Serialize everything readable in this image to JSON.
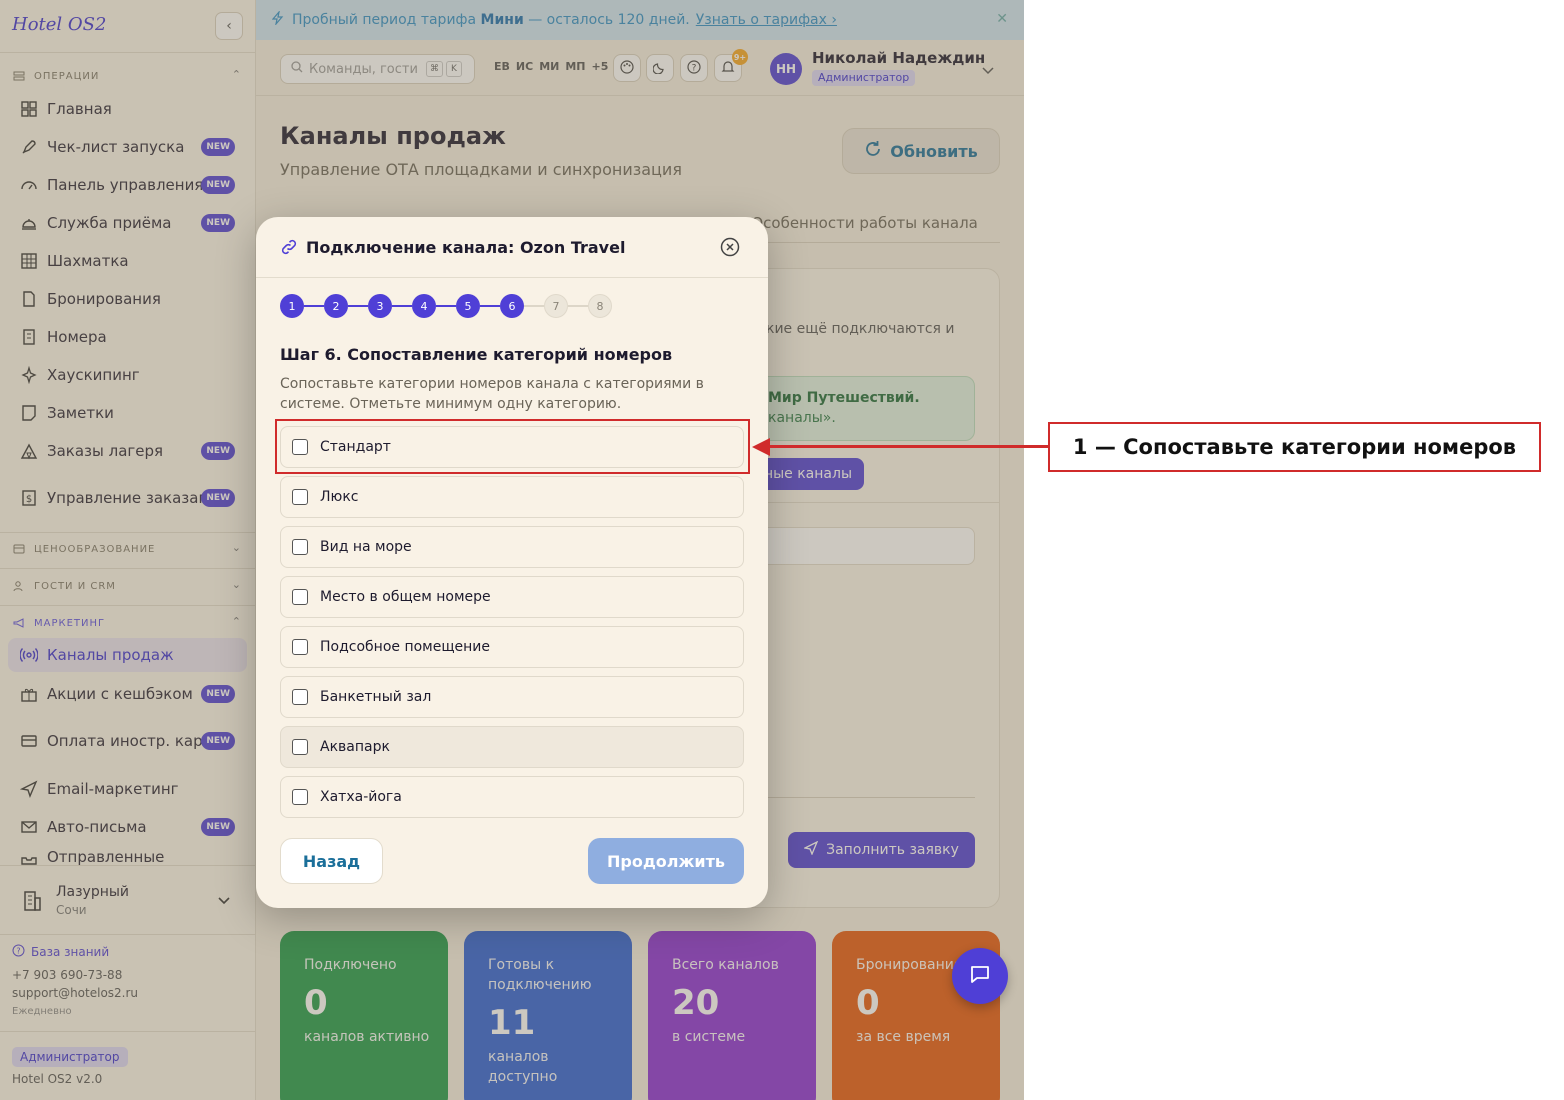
{
  "sidebar": {
    "logo": "Hotel OS2",
    "collapse_icon": "chevron-left-icon",
    "sections": {
      "operations": "ОПЕРАЦИИ",
      "pricing": "ЦЕНООБРАЗОВАНИЕ",
      "guests": "ГОСТИ И CRM",
      "marketing": "МАРКЕТИНГ"
    },
    "items": [
      {
        "label": "Главная",
        "icon": "grid-icon",
        "badge": ""
      },
      {
        "label": "Чек-лист запуска",
        "icon": "rocket-icon",
        "badge": "NEW"
      },
      {
        "label": "Панель управления",
        "icon": "gauge-icon",
        "badge": "NEW"
      },
      {
        "label": "Служба приёма",
        "icon": "bell-desk-icon",
        "badge": "NEW"
      },
      {
        "label": "Шахматка",
        "icon": "table-icon",
        "badge": ""
      },
      {
        "label": "Бронирования",
        "icon": "document-icon",
        "badge": ""
      },
      {
        "label": "Номера",
        "icon": "building-icon",
        "badge": ""
      },
      {
        "label": "Хаускипинг",
        "icon": "sparkles-icon",
        "badge": ""
      },
      {
        "label": "Заметки",
        "icon": "note-icon",
        "badge": ""
      },
      {
        "label": "Заказы лагеря",
        "icon": "tent-icon",
        "badge": "NEW"
      },
      {
        "label": "Управление заказами",
        "icon": "dollar-icon",
        "badge": "NEW"
      }
    ],
    "marketing_items": [
      {
        "label": "Каналы продаж",
        "icon": "broadcast-icon",
        "badge": ""
      },
      {
        "label": "Акции с кешбэком",
        "icon": "gift-icon",
        "badge": "NEW"
      },
      {
        "label": "Оплата иностр. картой",
        "icon": "card-icon",
        "badge": "NEW"
      },
      {
        "label": "Email-маркетинг",
        "icon": "send-icon",
        "badge": ""
      },
      {
        "label": "Авто-письма",
        "icon": "mail-icon",
        "badge": "NEW"
      },
      {
        "label": "Отправленные",
        "icon": "outbox-icon",
        "badge": ""
      }
    ],
    "hotel": {
      "name": "Лазурный",
      "city": "Сочи"
    },
    "footer": {
      "knowledge_base": "База знаний",
      "phone": "+7 903 690-73-88",
      "email": "support@hotelos2.ru",
      "hours": "Ежедневно",
      "role": "Администратор",
      "version": "Hotel OS2 v2.0"
    }
  },
  "trial_banner": {
    "prefix": "Пробный период тарифа",
    "plan": "Мини",
    "suffix": "— осталось 120 дней.",
    "link": "Узнать о тарифах ›"
  },
  "topbar": {
    "search_placeholder": "Команды, гости",
    "kbd1": "⌘",
    "kbd2": "K",
    "avatars": [
      "ЕВ",
      "ИС",
      "МИ",
      "МП",
      "+5"
    ],
    "notif_count": "9+",
    "user": {
      "initials": "НН",
      "name": "Николай Надеждин",
      "role": "Администратор"
    }
  },
  "page": {
    "title": "Каналы продаж",
    "subtitle": "Управление ОТА площадками и синхронизация",
    "refresh": "Обновить",
    "tab_features": "Особенности работы канала",
    "bg_text1": "кие ещё подключаются и",
    "bg_text2": "Мир Путешествий.",
    "bg_text3": "каналы».",
    "bg_button": "ные каналы",
    "apply_button": "Заполнить заявку"
  },
  "stats": [
    {
      "label": "Подключено",
      "value": "0",
      "unit": "каналов активно",
      "color": "#1f9a4a"
    },
    {
      "label": "Готовы к подключению",
      "value": "11",
      "unit": "каналов доступно",
      "color": "#2c5fd6"
    },
    {
      "label": "Всего каналов",
      "value": "20",
      "unit": "в системе",
      "color": "#8b2fd6"
    },
    {
      "label": "Бронирования",
      "value": "0",
      "unit": "за все время",
      "color": "#e65a10"
    }
  ],
  "modal": {
    "title": "Подключение канала: Ozon Travel",
    "steps": [
      "1",
      "2",
      "3",
      "4",
      "5",
      "6",
      "7",
      "8"
    ],
    "current_step": 6,
    "step_title": "Шаг 6. Сопоставление категорий номеров",
    "step_desc": "Сопоставьте категории номеров канала с категориями в системе. Отметьте минимум одну категорию.",
    "categories": [
      "Стандарт",
      "Люкс",
      "Вид на море",
      "Место в общем номере",
      "Подсобное помещение",
      "Банкетный зал",
      "Аквапарк",
      "Хатха-йога"
    ],
    "back": "Назад",
    "next": "Продолжить"
  },
  "annotation": {
    "label": "1 — Сопоставьте категории номеров",
    "color": "#d02b2b"
  }
}
